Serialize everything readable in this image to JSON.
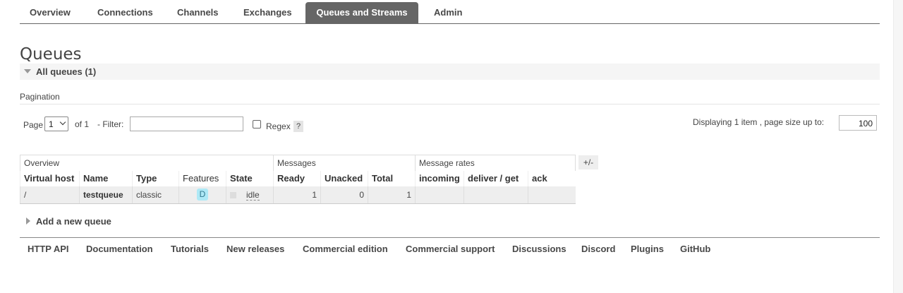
{
  "nav": {
    "tabs": [
      {
        "label": "Overview"
      },
      {
        "label": "Connections"
      },
      {
        "label": "Channels"
      },
      {
        "label": "Exchanges"
      },
      {
        "label": "Queues and Streams",
        "active": true
      },
      {
        "label": "Admin"
      }
    ]
  },
  "page": {
    "title": "Queues",
    "all_queues_label": "All queues (1)"
  },
  "pagination": {
    "title": "Pagination",
    "page_label": "Page",
    "page_value": "1",
    "of_label": "of 1",
    "filter_label": "- Filter:",
    "filter_value": "",
    "regex_label": "Regex",
    "regex_checked": false,
    "help_label": "?",
    "display_label": "Displaying 1 item , page size up to:",
    "page_size": "100"
  },
  "table": {
    "group_headers": {
      "overview": "Overview",
      "messages": "Messages",
      "message_rates": "Message rates"
    },
    "columns": {
      "virtual_host": "Virtual host",
      "name": "Name",
      "type": "Type",
      "features": "Features",
      "state": "State",
      "ready": "Ready",
      "unacked": "Unacked",
      "total": "Total",
      "incoming": "incoming",
      "deliver_get": "deliver / get",
      "ack": "ack"
    },
    "rows": [
      {
        "virtual_host": "/",
        "name": "testqueue",
        "type": "classic",
        "features": "D",
        "state": "idle",
        "ready": "1",
        "unacked": "0",
        "total": "1",
        "incoming": "",
        "deliver_get": "",
        "ack": ""
      }
    ],
    "toggle_columns_label": "+/-"
  },
  "add_queue": {
    "label": "Add a new queue"
  },
  "footer": {
    "links": [
      {
        "label": "HTTP API"
      },
      {
        "label": "Documentation"
      },
      {
        "label": "Tutorials"
      },
      {
        "label": "New releases"
      },
      {
        "label": "Commercial edition"
      },
      {
        "label": "Commercial support"
      },
      {
        "label": "Discussions"
      },
      {
        "label": "Discord"
      },
      {
        "label": "Plugins"
      },
      {
        "label": "GitHub"
      }
    ]
  },
  "colors": {
    "active_tab_bg": "#666666",
    "feature_badge_bg": "#aee9f6",
    "row_bg": "#eeeeee"
  }
}
